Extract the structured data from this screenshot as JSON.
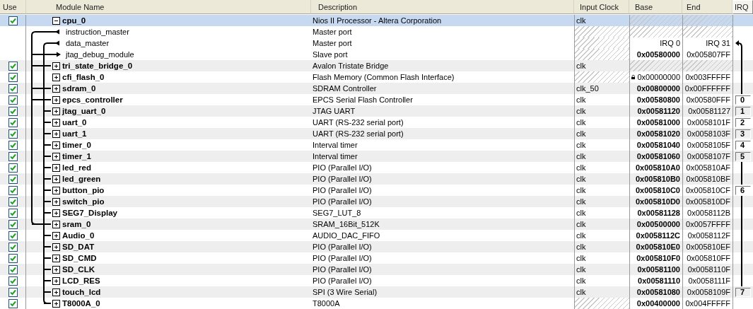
{
  "columns": [
    "Use",
    "Module Name",
    "Description",
    "Input Clock",
    "Base",
    "End",
    "IRQ"
  ],
  "modules": [
    {
      "name": "cpu_0",
      "used": true,
      "expanded": true,
      "selected": true,
      "description": "Nios II Processor - Altera Corporation",
      "clock": "clk",
      "ports": [
        {
          "name": "instruction_master",
          "kind": "master",
          "description": "Master port"
        },
        {
          "name": "data_master",
          "kind": "master",
          "description": "Master port",
          "base": "IRQ 0",
          "end": "IRQ 31"
        },
        {
          "name": "jtag_debug_module",
          "kind": "slave",
          "description": "Slave port",
          "base": "0x00580000",
          "end": "0x005807FF"
        }
      ]
    },
    {
      "name": "tri_state_bridge_0",
      "used": true,
      "expanded": false,
      "selected": false,
      "description": "Avalon Tristate Bridge",
      "clock": "clk"
    },
    {
      "name": "cfi_flash_0",
      "used": true,
      "expanded": false,
      "selected": false,
      "description": "Flash Memory (Common Flash Interface)",
      "locked": true,
      "base": "0x00000000",
      "end": "0x003FFFFF"
    },
    {
      "name": "sdram_0",
      "used": true,
      "expanded": false,
      "selected": false,
      "description": "SDRAM Controller",
      "clock": "clk_50",
      "base": "0x00800000",
      "end": "0x00FFFFFF"
    },
    {
      "name": "epcs_controller",
      "used": true,
      "expanded": false,
      "selected": false,
      "description": "EPCS Serial Flash Controller",
      "clock": "clk",
      "base": "0x00580800",
      "end": "0x00580FFF",
      "irq": "0"
    },
    {
      "name": "jtag_uart_0",
      "used": true,
      "expanded": false,
      "selected": false,
      "description": "JTAG UART",
      "clock": "clk",
      "base": "0x00581120",
      "end": "0x00581127",
      "irq": "1"
    },
    {
      "name": "uart_0",
      "used": true,
      "expanded": false,
      "selected": false,
      "description": "UART (RS-232 serial port)",
      "clock": "clk",
      "base": "0x00581000",
      "end": "0x0058101F",
      "irq": "2"
    },
    {
      "name": "uart_1",
      "used": true,
      "expanded": false,
      "selected": false,
      "description": "UART (RS-232 serial port)",
      "clock": "clk",
      "base": "0x00581020",
      "end": "0x0058103F",
      "irq": "3"
    },
    {
      "name": "timer_0",
      "used": true,
      "expanded": false,
      "selected": false,
      "description": "Interval timer",
      "clock": "clk",
      "base": "0x00581040",
      "end": "0x0058105F",
      "irq": "4"
    },
    {
      "name": "timer_1",
      "used": true,
      "expanded": false,
      "selected": false,
      "description": "Interval timer",
      "clock": "clk",
      "base": "0x00581060",
      "end": "0x0058107F",
      "irq": "5"
    },
    {
      "name": "led_red",
      "used": true,
      "expanded": false,
      "selected": false,
      "description": "PIO (Parallel I/O)",
      "clock": "clk",
      "base": "0x005810A0",
      "end": "0x005810AF"
    },
    {
      "name": "led_green",
      "used": true,
      "expanded": false,
      "selected": false,
      "description": "PIO (Parallel I/O)",
      "clock": "clk",
      "base": "0x005810B0",
      "end": "0x005810BF"
    },
    {
      "name": "button_pio",
      "used": true,
      "expanded": false,
      "selected": false,
      "description": "PIO (Parallel I/O)",
      "clock": "clk",
      "base": "0x005810C0",
      "end": "0x005810CF",
      "irq": "6"
    },
    {
      "name": "switch_pio",
      "used": true,
      "expanded": false,
      "selected": false,
      "description": "PIO (Parallel I/O)",
      "clock": "clk",
      "base": "0x005810D0",
      "end": "0x005810DF"
    },
    {
      "name": "SEG7_Display",
      "used": true,
      "expanded": false,
      "selected": false,
      "description": "SEG7_LUT_8",
      "clock": "clk",
      "base": "0x00581128",
      "end": "0x0058112B"
    },
    {
      "name": "sram_0",
      "used": true,
      "expanded": false,
      "selected": false,
      "description": "SRAM_16Bit_512K",
      "clock": "clk",
      "base": "0x00500000",
      "end": "0x0057FFFF"
    },
    {
      "name": "Audio_0",
      "used": true,
      "expanded": false,
      "selected": false,
      "description": "AUDIO_DAC_FIFO",
      "clock": "clk",
      "base": "0x0058112C",
      "end": "0x0058112F"
    },
    {
      "name": "SD_DAT",
      "used": true,
      "expanded": false,
      "selected": false,
      "description": "PIO (Parallel I/O)",
      "clock": "clk",
      "base": "0x005810E0",
      "end": "0x005810EF"
    },
    {
      "name": "SD_CMD",
      "used": true,
      "expanded": false,
      "selected": false,
      "description": "PIO (Parallel I/O)",
      "clock": "clk",
      "base": "0x005810F0",
      "end": "0x005810FF"
    },
    {
      "name": "SD_CLK",
      "used": true,
      "expanded": false,
      "selected": false,
      "description": "PIO (Parallel I/O)",
      "clock": "clk",
      "base": "0x00581100",
      "end": "0x0058110F"
    },
    {
      "name": "LCD_RES",
      "used": true,
      "expanded": false,
      "selected": false,
      "description": "PIO (Parallel I/O)",
      "clock": "clk",
      "base": "0x00581110",
      "end": "0x0058111F"
    },
    {
      "name": "touch_lcd",
      "used": true,
      "expanded": false,
      "selected": false,
      "description": "SPI (3 Wire Serial)",
      "clock": "clk",
      "base": "0x00581080",
      "end": "0x0058109F",
      "irq": "7"
    },
    {
      "name": "T8000A_0",
      "used": true,
      "expanded": false,
      "selected": false,
      "description": "T8000A",
      "base": "0x00400000",
      "end": "0x004FFFFF"
    }
  ]
}
